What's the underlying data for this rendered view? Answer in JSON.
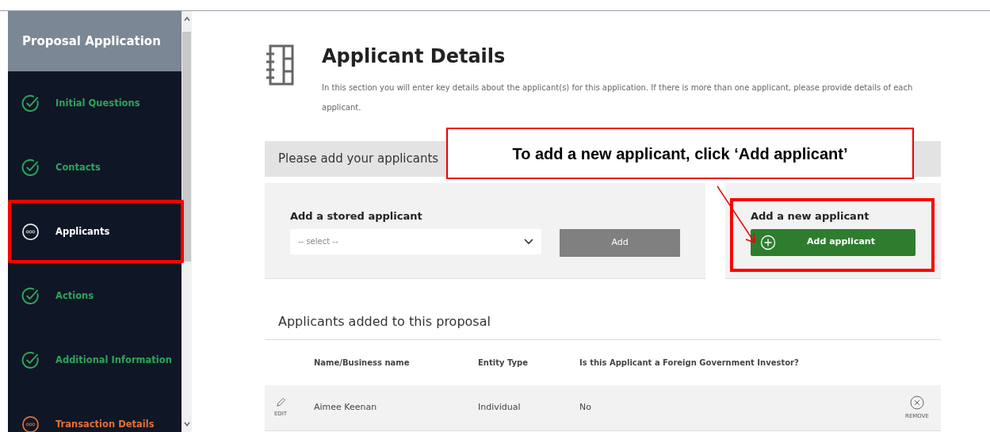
{
  "sidebar": {
    "title": "Proposal Application",
    "items": [
      {
        "label": "Initial Questions",
        "kind": "done",
        "selected": false
      },
      {
        "label": "Contacts",
        "kind": "done",
        "selected": false
      },
      {
        "label": "Applicants",
        "kind": "current",
        "selected": true
      },
      {
        "label": "Actions",
        "kind": "done",
        "selected": false
      },
      {
        "label": "Additional Information",
        "kind": "done",
        "selected": false
      },
      {
        "label": "Transaction Details",
        "kind": "pending",
        "selected": false
      }
    ]
  },
  "page": {
    "title": "Applicant Details",
    "description": "In this section you will enter key details about the applicant(s) for this application. If there is more than one applicant, please provide details of each applicant."
  },
  "add_section": {
    "heading": "Please add your applicants",
    "stored": {
      "label": "Add a stored applicant",
      "placeholder": "-- select --",
      "button": "Add"
    },
    "new": {
      "label": "Add a new applicant",
      "button": "Add applicant"
    }
  },
  "applicants": {
    "heading": "Applicants added to this proposal",
    "columns": [
      "Name/Business name",
      "Entity Type",
      "Is this Applicant a Foreign Government Investor?"
    ],
    "rows": [
      {
        "edit": "EDIT",
        "cells": [
          "Aimee Keenan",
          "Individual",
          "No"
        ],
        "remove": "REMOVE"
      }
    ]
  },
  "annotation": {
    "callout": "To add a new applicant, click ‘Add applicant’"
  }
}
